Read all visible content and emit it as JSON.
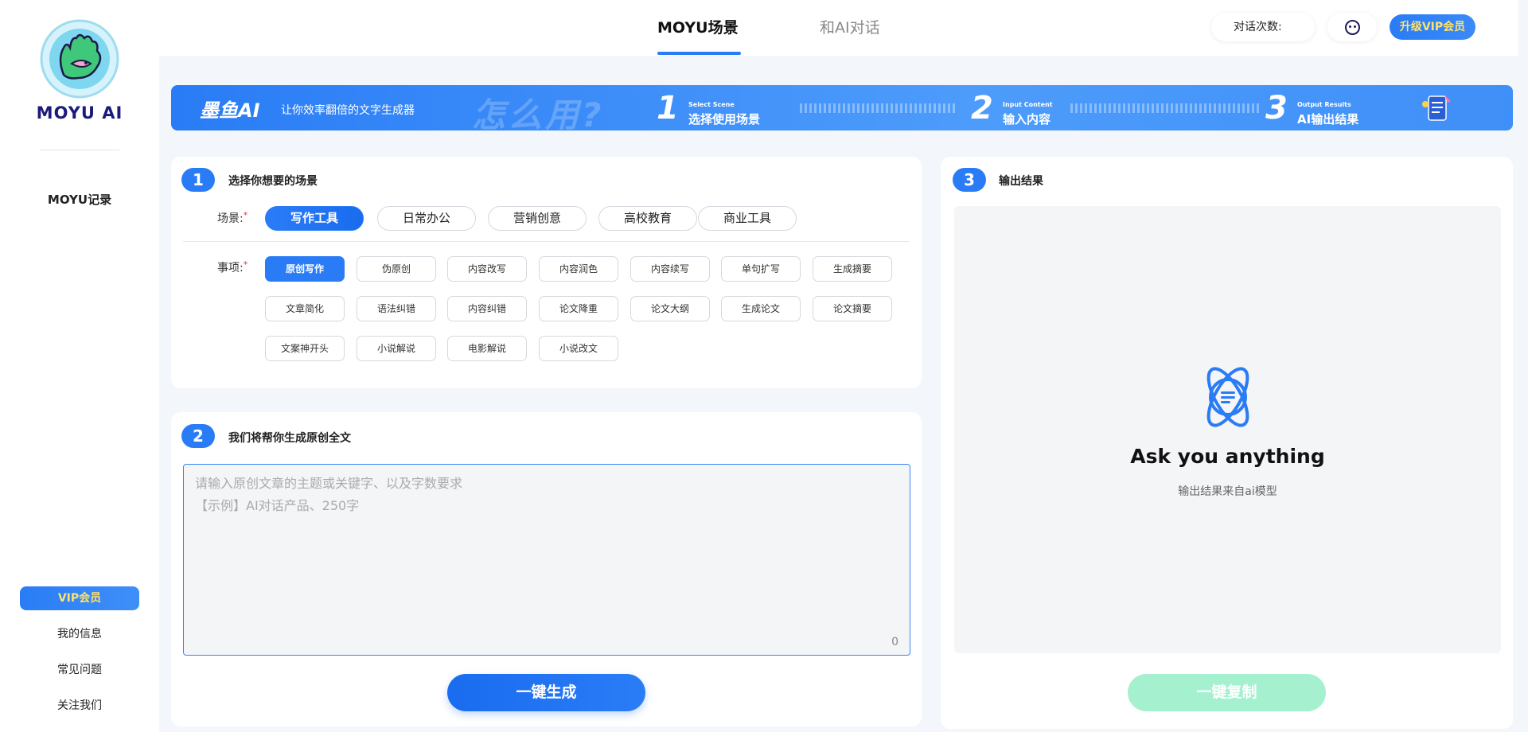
{
  "sidebar": {
    "logo_text": "MOYU AI",
    "record_label": "MOYU记录",
    "vip_label": "VIP会员",
    "links": [
      "我的信息",
      "常见问题",
      "关注我们"
    ]
  },
  "topbar": {
    "tabs": [
      "MOYU场景",
      "和AI对话"
    ],
    "chat_count_label": "对话次数:",
    "upgrade_label": "升级VIP会员"
  },
  "banner": {
    "brand": "墨鱼AI",
    "slogan": "让你效率翻倍的文字生成器",
    "watermark": "怎么用?",
    "steps": [
      {
        "num": "1",
        "en": "Select Scene",
        "cn": "选择使用场景"
      },
      {
        "num": "2",
        "en": "Input Content",
        "cn": "输入内容"
      },
      {
        "num": "3",
        "en": "Output Results",
        "cn": "AI输出结果"
      }
    ]
  },
  "card1": {
    "badge": "1",
    "title": "选择你想要的场景",
    "scene_label": "场景:",
    "scenes": [
      "写作工具",
      "日常办公",
      "营销创意",
      "高校教育",
      "商业工具"
    ],
    "active_scene": "写作工具",
    "item_label": "事项:",
    "items": [
      "原创写作",
      "伪原创",
      "内容改写",
      "内容润色",
      "内容续写",
      "单句扩写",
      "生成摘要",
      "文章简化",
      "语法纠错",
      "内容纠错",
      "论文降重",
      "论文大纲",
      "生成论文",
      "论文摘要",
      "文案神开头",
      "小说解说",
      "电影解说",
      "小说改文"
    ],
    "active_item": "原创写作"
  },
  "card2": {
    "badge": "2",
    "title": "我们将帮你生成原创全文",
    "placeholder": "请输入原创文章的主题或关键字、以及字数要求\n【示例】AI对话产品、250字",
    "value": "",
    "char_count": "0",
    "generate_label": "一键生成"
  },
  "card3": {
    "badge": "3",
    "title": "输出结果",
    "output_title": "Ask you anything",
    "output_sub": "输出结果来自ai模型",
    "copy_label": "一键复制"
  },
  "colors": {
    "primary": "#2a7cf6",
    "vip_text": "#ffe26a",
    "copy_disabled": "#a5f1cf",
    "brand_dark": "#1b1b7a"
  },
  "icons": [
    "moyu-logo-icon",
    "avatar-icon",
    "banner-clipboard-icon",
    "atom-icon"
  ]
}
